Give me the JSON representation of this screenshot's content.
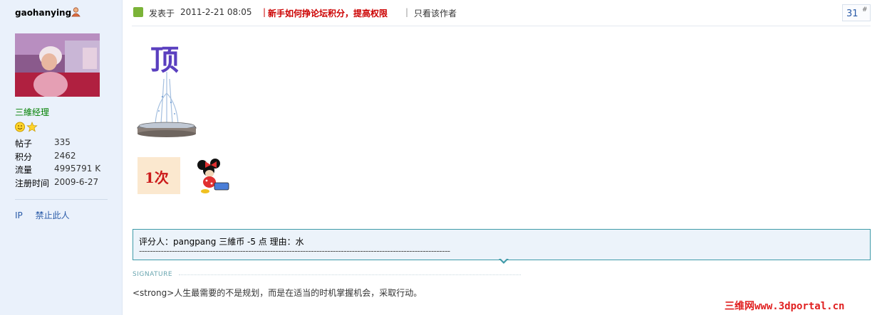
{
  "user": {
    "username": "gaohanying",
    "rank": "三維经理",
    "stats": [
      {
        "label": "帖子",
        "value": "335"
      },
      {
        "label": "积分",
        "value": "2462"
      },
      {
        "label": "流量",
        "value": "4995791 K"
      },
      {
        "label": "注册时间",
        "value": "2009-6-27"
      }
    ],
    "actions": {
      "ip": "IP",
      "ban": "禁止此人"
    }
  },
  "post": {
    "posted_label": "发表于",
    "posted_time": "2011-2-21 08:05",
    "notice_link": "新手如何挣论坛积分，提高权限",
    "author_only": "只看该作者",
    "floor_number": "31",
    "floor_hash": "#",
    "ding_char": "顶",
    "count_badge": "1次"
  },
  "rating": {
    "line": "评分人：pangpang 三維币  -5 点  理由：水",
    "dashes": "------------------------------------------------------------------------------------------------------------------"
  },
  "signature": {
    "label": "SIGNATURE",
    "text": "<strong>人生最需要的不是规划，而是在适当的时机掌握机会，采取行动。"
  },
  "watermark": "三维网www.3dportal.cn",
  "colors": {
    "accent": "#3f9aa8",
    "notice": "#cc0000",
    "rank": "#008000",
    "sidebar_bg": "#eaf1fb"
  }
}
